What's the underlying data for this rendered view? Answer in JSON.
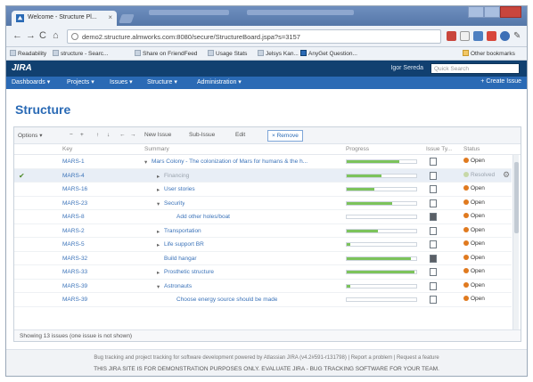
{
  "browser": {
    "tab_title": "Welcome - Structure Pl...",
    "tab_close": "×",
    "url": "demo2.structure.almworks.com:8080/secure/StructureBoard.jspa?s=3157",
    "bookmarks": [
      {
        "label": "Readability"
      },
      {
        "label": "structure - Searc..."
      },
      {
        "label": "Share on FriendFeed"
      },
      {
        "label": "Usage Stats"
      },
      {
        "label": "Jelsys Kan..."
      },
      {
        "label": "AnyGet Question..."
      }
    ],
    "other_bookmarks": "Other bookmarks",
    "colors": {
      "accent": "#2a6ab5",
      "header": "#114070"
    }
  },
  "jira": {
    "logo": "JIRA",
    "user": "Igor Sereda",
    "search_placeholder": "Quick Search",
    "nav": [
      {
        "label": "Dashboards ▾"
      },
      {
        "label": "Projects ▾"
      },
      {
        "label": "Issues ▾"
      },
      {
        "label": "Structure ▾"
      },
      {
        "label": "Administration ▾"
      }
    ],
    "create_issue": "+ Create Issue"
  },
  "structure": {
    "title": "Structure",
    "toolbar": {
      "options": "Options ▾",
      "collapse": "−",
      "expand": "+",
      "move_up": "↑",
      "move_down": "↓",
      "move_left": "←",
      "move_right": "→",
      "new_issue": "New Issue",
      "sub_issue": "Sub-Issue",
      "edit": "Edit",
      "remove": "× Remove"
    },
    "columns": {
      "key": "Key",
      "summary": "Summary",
      "progress": "Progress",
      "issue_type": "Issue Ty...",
      "status": "Status"
    },
    "rows": [
      {
        "key": "MARS-1",
        "summary": "Mars Colony - The colonization of Mars for humans & the h...",
        "indent": 0,
        "expander": "▾",
        "progress": 0.75,
        "type_dark": false,
        "status": "Open",
        "selected": false
      },
      {
        "key": "MARS-4",
        "summary": "Financing",
        "indent": 1,
        "expander": "▸",
        "progress": 0.5,
        "type_dark": false,
        "status": "Resolved",
        "selected": true
      },
      {
        "key": "MARS-16",
        "summary": "User stories",
        "indent": 1,
        "expander": "▸",
        "progress": 0.4,
        "type_dark": false,
        "status": "Open",
        "selected": false
      },
      {
        "key": "MARS-23",
        "summary": "Security",
        "indent": 1,
        "expander": "▾",
        "progress": 0.65,
        "type_dark": false,
        "status": "Open",
        "selected": false
      },
      {
        "key": "MARS-8",
        "summary": "Add other holes/boat",
        "indent": 2,
        "expander": "",
        "progress": 0,
        "type_dark": true,
        "status": "Open",
        "selected": false
      },
      {
        "key": "MARS-2",
        "summary": "Transportation",
        "indent": 1,
        "expander": "▸",
        "progress": 0.45,
        "type_dark": false,
        "status": "Open",
        "selected": false
      },
      {
        "key": "MARS-5",
        "summary": "Life support BR",
        "indent": 1,
        "expander": "▸",
        "progress": 0.05,
        "type_dark": false,
        "status": "Open",
        "selected": false
      },
      {
        "key": "MARS-32",
        "summary": "Build hangar",
        "indent": 1,
        "expander": "",
        "progress": 0.92,
        "type_dark": true,
        "status": "Open",
        "selected": false
      },
      {
        "key": "MARS-33",
        "summary": "Prosthetic structure",
        "indent": 1,
        "expander": "▸",
        "progress": 0.98,
        "type_dark": false,
        "status": "Open",
        "selected": false
      },
      {
        "key": "MARS-39",
        "summary": "Astronauts",
        "indent": 1,
        "expander": "▾",
        "progress": 0.05,
        "type_dark": false,
        "status": "Open",
        "selected": false
      },
      {
        "key": "MARS-39",
        "summary": "Choose energy source should be made",
        "indent": 2,
        "expander": "",
        "progress": 0,
        "type_dark": false,
        "status": "Open",
        "selected": false
      }
    ],
    "footer_text": "Showing 13 issues (one issue is not shown)"
  },
  "footer": {
    "line1": "Bug tracking and project tracking for software development powered by Atlassian JIRA (v4.2#591-r131798) | Report a problem | Request a feature",
    "line2": "THIS JIRA SITE IS FOR DEMONSTRATION PURPOSES ONLY. EVALUATE JIRA - BUG TRACKING SOFTWARE FOR YOUR TEAM."
  }
}
